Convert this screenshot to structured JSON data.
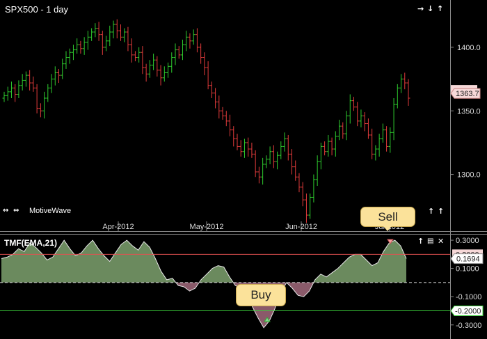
{
  "chart": {
    "title": "SPX500 - 1 day",
    "watermark": "MotiveWave",
    "price_labels": [
      "1400.0",
      "1350.0",
      "1300.0"
    ],
    "price_values": [
      1400,
      1350,
      1300
    ],
    "current_price": "1363.7",
    "current_price_value": 1363.7,
    "prev_price_value": 1366.5,
    "date_labels": [
      "Apr-2012",
      "May-2012",
      "Jun-2012",
      "Jul-2012"
    ],
    "price_range": [
      1262,
      1435
    ],
    "colors": {
      "up": "#2ecc2e",
      "down": "#e23b3b",
      "panel_border": "#8a8a8a",
      "price_tag": "#f6d8d8"
    }
  },
  "indicator": {
    "title": "TMF(EMA,21)",
    "value_labels": [
      "0.3000",
      "0.1000",
      "-0.1000",
      "-0.3000"
    ],
    "value_values": [
      0.3,
      0.1,
      -0.1,
      -0.3
    ],
    "current_value": "0.1694",
    "current_value_num": 0.1694,
    "upper_threshold": "0.2000",
    "upper_threshold_value": 0.2,
    "lower_threshold": "-0.2000",
    "lower_threshold_value": -0.2,
    "zero_value": 0,
    "range": [
      -0.38,
      0.33
    ],
    "colors": {
      "positive_fill": "#6b8a5e",
      "negative_fill": "#8a5a6a",
      "upper_line": "#e05050",
      "lower_line": "#3bcf3b"
    },
    "values": [
      0.17,
      0.18,
      0.2,
      0.24,
      0.22,
      0.28,
      0.25,
      0.21,
      0.16,
      0.18,
      0.24,
      0.3,
      0.24,
      0.19,
      0.21,
      0.26,
      0.3,
      0.24,
      0.19,
      0.15,
      0.21,
      0.27,
      0.3,
      0.26,
      0.23,
      0.29,
      0.25,
      0.17,
      0.08,
      0.02,
      0.03,
      -0.02,
      -0.03,
      -0.06,
      -0.04,
      0.02,
      0.06,
      0.1,
      0.12,
      0.11,
      0.04,
      -0.02,
      -0.04,
      -0.08,
      -0.17,
      -0.25,
      -0.32,
      -0.27,
      -0.18,
      -0.07,
      0.0,
      -0.04,
      -0.09,
      -0.1,
      -0.06,
      0.02,
      0.06,
      0.04,
      0.07,
      0.1,
      0.14,
      0.18,
      0.2,
      0.2,
      0.16,
      0.12,
      0.14,
      0.22,
      0.28,
      0.3,
      0.26,
      0.17
    ]
  },
  "signals": {
    "sell": "Sell",
    "buy": "Buy"
  },
  "controls": {
    "top_arrows": "➜ ➜ ➜",
    "nav_left": "⟵ ⟶",
    "scroll_up": "⇧ ⇧"
  }
}
